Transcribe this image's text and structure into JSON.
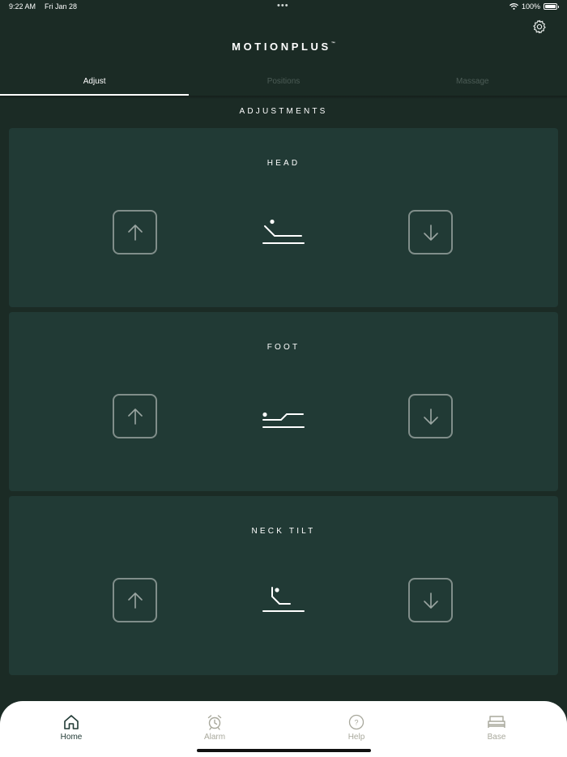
{
  "status_bar": {
    "time": "9:22 AM",
    "date": "Fri Jan 28",
    "dots": "•••",
    "battery": "100%",
    "icons": [
      "wifi-icon",
      "battery-icon"
    ]
  },
  "header": {
    "title": "MOTIONPLUS",
    "trademark": "™",
    "settings_icon": "gear-icon"
  },
  "tabs": [
    {
      "label": "Adjust",
      "active": true
    },
    {
      "label": "Positions",
      "active": false
    },
    {
      "label": "Massage",
      "active": false
    }
  ],
  "section_title": "ADJUSTMENTS",
  "cards": [
    {
      "title": "HEAD",
      "icon": "bed-head-raised-icon"
    },
    {
      "title": "FOOT",
      "icon": "bed-foot-raised-icon"
    },
    {
      "title": "NECK TILT",
      "icon": "bed-neck-tilt-icon"
    }
  ],
  "bottom_nav": [
    {
      "label": "Home",
      "icon": "home-icon",
      "active": true
    },
    {
      "label": "Alarm",
      "icon": "alarm-clock-icon",
      "active": false
    },
    {
      "label": "Help",
      "icon": "help-icon",
      "active": false
    },
    {
      "label": "Base",
      "icon": "bed-icon",
      "active": false
    }
  ],
  "colors": {
    "background": "#1b2b25",
    "card": "#213a35",
    "button_border": "#808e8a",
    "nav_active": "#213a35",
    "nav_inactive": "#a8a89c"
  }
}
